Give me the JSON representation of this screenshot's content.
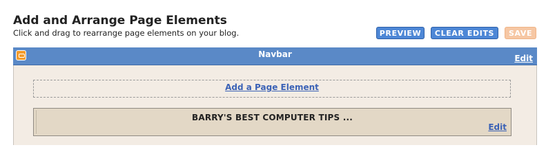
{
  "header": {
    "title": "Add and Arrange Page Elements",
    "subtitle": "Click and drag to rearrange page elements on your blog."
  },
  "toolbar": {
    "preview_label": "PREVIEW",
    "clear_edits_label": "CLEAR EDITS",
    "save_label": "SAVE"
  },
  "navbar": {
    "icon": "blogger-icon",
    "label": "Navbar",
    "edit_label": "Edit"
  },
  "layout": {
    "add_element_label": "Add a Page Element",
    "widgets": [
      {
        "title": "BARRY'S BEST COMPUTER TIPS ...",
        "edit_label": "Edit"
      }
    ]
  },
  "colors": {
    "accent_button": "#4d87d6",
    "save_disabled": "#f6c7a4",
    "navbar_bg": "#5a89c7",
    "panel_bg": "#f3ece4",
    "widget_bg": "#e3d8c6",
    "link": "#3b62b6"
  }
}
